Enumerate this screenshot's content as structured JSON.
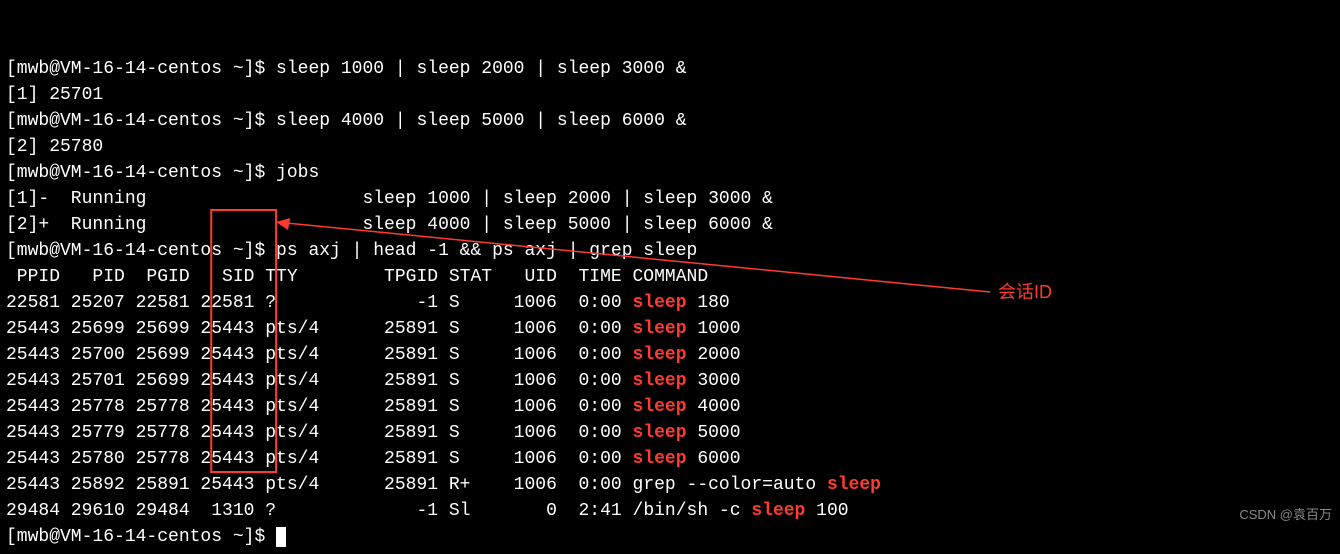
{
  "prompt": {
    "user": "mwb",
    "host": "VM-16-14-centos",
    "dir": "~"
  },
  "commands": [
    {
      "cmd": "sleep 1000 | sleep 2000 | sleep 3000 &",
      "job": "[1] 25701"
    },
    {
      "cmd": "sleep 4000 | sleep 5000 | sleep 6000 &",
      "job": "[2] 25780"
    }
  ],
  "jobs_cmd": "jobs",
  "jobs": [
    {
      "id": "[1]-",
      "state": "Running",
      "text": "sleep 1000 | sleep 2000 | sleep 3000 &"
    },
    {
      "id": "[2]+",
      "state": "Running",
      "text": "sleep 4000 | sleep 5000 | sleep 6000 &"
    }
  ],
  "ps_cmd": "ps axj | head -1 && ps axj | grep sleep",
  "hdr": {
    "PPID": "PPID",
    "PID": "PID",
    "PGID": "PGID",
    "SID": "SID",
    "TTY": "TTY",
    "TPGID": "TPGID",
    "STAT": "STAT",
    "UID": "UID",
    "TIME": "TIME",
    "COMMAND": "COMMAND"
  },
  "rows": [
    {
      "ppid": "22581",
      "pid": "25207",
      "pgid": "22581",
      "sid": "22581",
      "tty": "?",
      "tpgid": "-1",
      "stat": "S",
      "uid": "1006",
      "time": "0:00",
      "cmd": [
        "sleep",
        " 180"
      ],
      "hl": [
        0
      ]
    },
    {
      "ppid": "25443",
      "pid": "25699",
      "pgid": "25699",
      "sid": "25443",
      "tty": "pts/4",
      "tpgid": "25891",
      "stat": "S",
      "uid": "1006",
      "time": "0:00",
      "cmd": [
        "sleep",
        " 1000"
      ],
      "hl": [
        0
      ]
    },
    {
      "ppid": "25443",
      "pid": "25700",
      "pgid": "25699",
      "sid": "25443",
      "tty": "pts/4",
      "tpgid": "25891",
      "stat": "S",
      "uid": "1006",
      "time": "0:00",
      "cmd": [
        "sleep",
        " 2000"
      ],
      "hl": [
        0
      ]
    },
    {
      "ppid": "25443",
      "pid": "25701",
      "pgid": "25699",
      "sid": "25443",
      "tty": "pts/4",
      "tpgid": "25891",
      "stat": "S",
      "uid": "1006",
      "time": "0:00",
      "cmd": [
        "sleep",
        " 3000"
      ],
      "hl": [
        0
      ]
    },
    {
      "ppid": "25443",
      "pid": "25778",
      "pgid": "25778",
      "sid": "25443",
      "tty": "pts/4",
      "tpgid": "25891",
      "stat": "S",
      "uid": "1006",
      "time": "0:00",
      "cmd": [
        "sleep",
        " 4000"
      ],
      "hl": [
        0
      ]
    },
    {
      "ppid": "25443",
      "pid": "25779",
      "pgid": "25778",
      "sid": "25443",
      "tty": "pts/4",
      "tpgid": "25891",
      "stat": "S",
      "uid": "1006",
      "time": "0:00",
      "cmd": [
        "sleep",
        " 5000"
      ],
      "hl": [
        0
      ]
    },
    {
      "ppid": "25443",
      "pid": "25780",
      "pgid": "25778",
      "sid": "25443",
      "tty": "pts/4",
      "tpgid": "25891",
      "stat": "S",
      "uid": "1006",
      "time": "0:00",
      "cmd": [
        "sleep",
        " 6000"
      ],
      "hl": [
        0
      ]
    },
    {
      "ppid": "25443",
      "pid": "25892",
      "pgid": "25891",
      "sid": "25443",
      "tty": "pts/4",
      "tpgid": "25891",
      "stat": "R+",
      "uid": "1006",
      "time": "0:00",
      "cmd": [
        "grep --color=auto ",
        "sleep"
      ],
      "hl": [
        1
      ]
    },
    {
      "ppid": "29484",
      "pid": "29610",
      "pgid": "29484",
      "sid": "1310",
      "tty": "?",
      "tpgid": "-1",
      "stat": "Sl",
      "uid": "0",
      "time": "2:41",
      "cmd": [
        "/bin/sh -c ",
        "sleep",
        " 100"
      ],
      "hl": [
        1
      ]
    }
  ],
  "annotation": {
    "label": "会话ID",
    "color": "#ff3b30"
  },
  "watermark": "CSDN @袁百万"
}
